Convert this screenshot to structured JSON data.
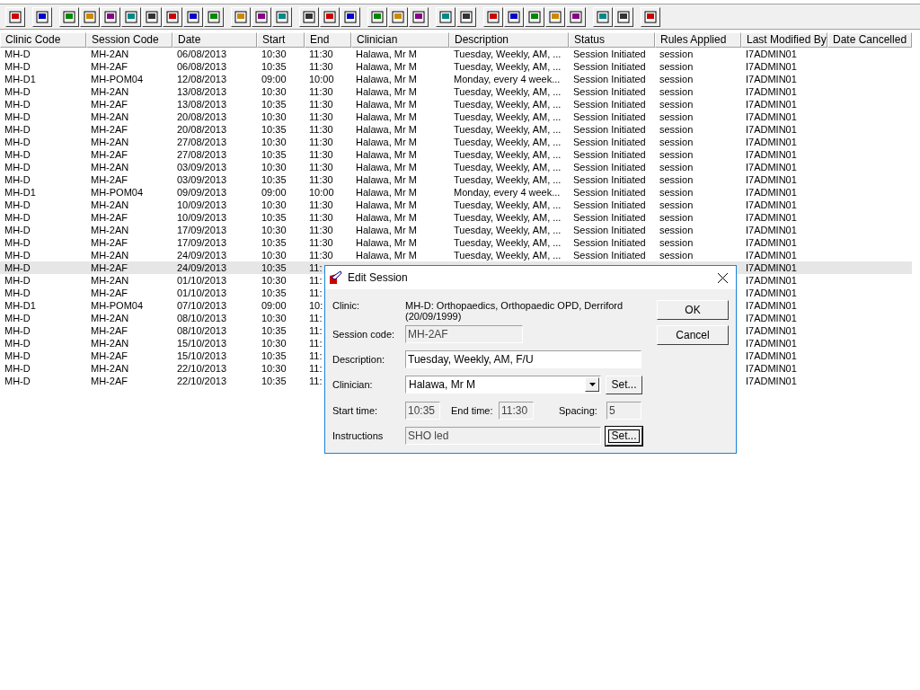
{
  "table": {
    "columns": [
      "Clinic Code",
      "Session Code",
      "Date",
      "Start",
      "End",
      "Clinician",
      "Description",
      "Status",
      "Rules Applied",
      "Last Modified By",
      "Date Cancelled"
    ],
    "rows": [
      {
        "clinic_code": "MH-D",
        "session_code": "MH-2AN",
        "date": "06/08/2013",
        "start": "10:30",
        "end": "11:30",
        "clinician": "Halawa, Mr M",
        "description": "Tuesday, Weekly, AM, ...",
        "status": "Session Initiated",
        "rules_applied": "session",
        "last_modified_by": "I7ADMIN01",
        "selected": false
      },
      {
        "clinic_code": "MH-D",
        "session_code": "MH-2AF",
        "date": "06/08/2013",
        "start": "10:35",
        "end": "11:30",
        "clinician": "Halawa, Mr M",
        "description": "Tuesday, Weekly, AM, ...",
        "status": "Session Initiated",
        "rules_applied": "session",
        "last_modified_by": "I7ADMIN01",
        "selected": false
      },
      {
        "clinic_code": "MH-D1",
        "session_code": "MH-POM04",
        "date": "12/08/2013",
        "start": "09:00",
        "end": "10:00",
        "clinician": "Halawa, Mr M",
        "description": "Monday, every 4 week...",
        "status": "Session Initiated",
        "rules_applied": "session",
        "last_modified_by": "I7ADMIN01",
        "selected": false
      },
      {
        "clinic_code": "MH-D",
        "session_code": "MH-2AN",
        "date": "13/08/2013",
        "start": "10:30",
        "end": "11:30",
        "clinician": "Halawa, Mr M",
        "description": "Tuesday, Weekly, AM, ...",
        "status": "Session Initiated",
        "rules_applied": "session",
        "last_modified_by": "I7ADMIN01",
        "selected": false
      },
      {
        "clinic_code": "MH-D",
        "session_code": "MH-2AF",
        "date": "13/08/2013",
        "start": "10:35",
        "end": "11:30",
        "clinician": "Halawa, Mr M",
        "description": "Tuesday, Weekly, AM, ...",
        "status": "Session Initiated",
        "rules_applied": "session",
        "last_modified_by": "I7ADMIN01",
        "selected": false
      },
      {
        "clinic_code": "MH-D",
        "session_code": "MH-2AN",
        "date": "20/08/2013",
        "start": "10:30",
        "end": "11:30",
        "clinician": "Halawa, Mr M",
        "description": "Tuesday, Weekly, AM, ...",
        "status": "Session Initiated",
        "rules_applied": "session",
        "last_modified_by": "I7ADMIN01",
        "selected": false
      },
      {
        "clinic_code": "MH-D",
        "session_code": "MH-2AF",
        "date": "20/08/2013",
        "start": "10:35",
        "end": "11:30",
        "clinician": "Halawa, Mr M",
        "description": "Tuesday, Weekly, AM, ...",
        "status": "Session Initiated",
        "rules_applied": "session",
        "last_modified_by": "I7ADMIN01",
        "selected": false
      },
      {
        "clinic_code": "MH-D",
        "session_code": "MH-2AN",
        "date": "27/08/2013",
        "start": "10:30",
        "end": "11:30",
        "clinician": "Halawa, Mr M",
        "description": "Tuesday, Weekly, AM, ...",
        "status": "Session Initiated",
        "rules_applied": "session",
        "last_modified_by": "I7ADMIN01",
        "selected": false
      },
      {
        "clinic_code": "MH-D",
        "session_code": "MH-2AF",
        "date": "27/08/2013",
        "start": "10:35",
        "end": "11:30",
        "clinician": "Halawa, Mr M",
        "description": "Tuesday, Weekly, AM, ...",
        "status": "Session Initiated",
        "rules_applied": "session",
        "last_modified_by": "I7ADMIN01",
        "selected": false
      },
      {
        "clinic_code": "MH-D",
        "session_code": "MH-2AN",
        "date": "03/09/2013",
        "start": "10:30",
        "end": "11:30",
        "clinician": "Halawa, Mr M",
        "description": "Tuesday, Weekly, AM, ...",
        "status": "Session Initiated",
        "rules_applied": "session",
        "last_modified_by": "I7ADMIN01",
        "selected": false
      },
      {
        "clinic_code": "MH-D",
        "session_code": "MH-2AF",
        "date": "03/09/2013",
        "start": "10:35",
        "end": "11:30",
        "clinician": "Halawa, Mr M",
        "description": "Tuesday, Weekly, AM, ...",
        "status": "Session Initiated",
        "rules_applied": "session",
        "last_modified_by": "I7ADMIN01",
        "selected": false
      },
      {
        "clinic_code": "MH-D1",
        "session_code": "MH-POM04",
        "date": "09/09/2013",
        "start": "09:00",
        "end": "10:00",
        "clinician": "Halawa, Mr M",
        "description": "Monday, every 4 week...",
        "status": "Session Initiated",
        "rules_applied": "session",
        "last_modified_by": "I7ADMIN01",
        "selected": false
      },
      {
        "clinic_code": "MH-D",
        "session_code": "MH-2AN",
        "date": "10/09/2013",
        "start": "10:30",
        "end": "11:30",
        "clinician": "Halawa, Mr M",
        "description": "Tuesday, Weekly, AM, ...",
        "status": "Session Initiated",
        "rules_applied": "session",
        "last_modified_by": "I7ADMIN01",
        "selected": false
      },
      {
        "clinic_code": "MH-D",
        "session_code": "MH-2AF",
        "date": "10/09/2013",
        "start": "10:35",
        "end": "11:30",
        "clinician": "Halawa, Mr M",
        "description": "Tuesday, Weekly, AM, ...",
        "status": "Session Initiated",
        "rules_applied": "session",
        "last_modified_by": "I7ADMIN01",
        "selected": false
      },
      {
        "clinic_code": "MH-D",
        "session_code": "MH-2AN",
        "date": "17/09/2013",
        "start": "10:30",
        "end": "11:30",
        "clinician": "Halawa, Mr M",
        "description": "Tuesday, Weekly, AM, ...",
        "status": "Session Initiated",
        "rules_applied": "session",
        "last_modified_by": "I7ADMIN01",
        "selected": false
      },
      {
        "clinic_code": "MH-D",
        "session_code": "MH-2AF",
        "date": "17/09/2013",
        "start": "10:35",
        "end": "11:30",
        "clinician": "Halawa, Mr M",
        "description": "Tuesday, Weekly, AM, ...",
        "status": "Session Initiated",
        "rules_applied": "session",
        "last_modified_by": "I7ADMIN01",
        "selected": false
      },
      {
        "clinic_code": "MH-D",
        "session_code": "MH-2AN",
        "date": "24/09/2013",
        "start": "10:30",
        "end": "11:30",
        "clinician": "Halawa, Mr M",
        "description": "Tuesday, Weekly, AM, ...",
        "status": "Session Initiated",
        "rules_applied": "session",
        "last_modified_by": "I7ADMIN01",
        "selected": false
      },
      {
        "clinic_code": "MH-D",
        "session_code": "MH-2AF",
        "date": "24/09/2013",
        "start": "10:35",
        "end": "11:",
        "last_modified_by": "I7ADMIN01",
        "selected": true
      },
      {
        "clinic_code": "MH-D",
        "session_code": "MH-2AN",
        "date": "01/10/2013",
        "start": "10:30",
        "end": "11:",
        "last_modified_by": "I7ADMIN01",
        "selected": false
      },
      {
        "clinic_code": "MH-D",
        "session_code": "MH-2AF",
        "date": "01/10/2013",
        "start": "10:35",
        "end": "11:",
        "last_modified_by": "I7ADMIN01",
        "selected": false
      },
      {
        "clinic_code": "MH-D1",
        "session_code": "MH-POM04",
        "date": "07/10/2013",
        "start": "09:00",
        "end": "10:",
        "last_modified_by": "I7ADMIN01",
        "selected": false
      },
      {
        "clinic_code": "MH-D",
        "session_code": "MH-2AN",
        "date": "08/10/2013",
        "start": "10:30",
        "end": "11:",
        "last_modified_by": "I7ADMIN01",
        "selected": false
      },
      {
        "clinic_code": "MH-D",
        "session_code": "MH-2AF",
        "date": "08/10/2013",
        "start": "10:35",
        "end": "11:",
        "last_modified_by": "I7ADMIN01",
        "selected": false
      },
      {
        "clinic_code": "MH-D",
        "session_code": "MH-2AN",
        "date": "15/10/2013",
        "start": "10:30",
        "end": "11:",
        "last_modified_by": "I7ADMIN01",
        "selected": false
      },
      {
        "clinic_code": "MH-D",
        "session_code": "MH-2AF",
        "date": "15/10/2013",
        "start": "10:35",
        "end": "11:",
        "last_modified_by": "I7ADMIN01",
        "selected": false
      },
      {
        "clinic_code": "MH-D",
        "session_code": "MH-2AN",
        "date": "22/10/2013",
        "start": "10:30",
        "end": "11:",
        "last_modified_by": "I7ADMIN01",
        "selected": false
      },
      {
        "clinic_code": "MH-D",
        "session_code": "MH-2AF",
        "date": "22/10/2013",
        "start": "10:35",
        "end": "11:",
        "last_modified_by": "I7ADMIN01",
        "selected": false
      }
    ]
  },
  "dialog": {
    "title": "Edit Session",
    "clinic": {
      "label": "Clinic:",
      "value": "MH-D: Orthopaedics, Orthopaedic OPD, Derriford (20/09/1999)"
    },
    "session_code": {
      "label": "Session code:",
      "value": "MH-2AF",
      "disabled": true
    },
    "description": {
      "label": "Description:",
      "value": "Tuesday, Weekly, AM, F/U",
      "disabled": false
    },
    "clinician": {
      "label": "Clinician:",
      "value": "Halawa, Mr M",
      "disabled": false,
      "button": {
        "label": "Set...",
        "focused": false
      }
    },
    "start_time": {
      "label": "Start time:",
      "value": "10:35",
      "disabled": true
    },
    "end_time": {
      "label": "End time:",
      "value": "11:30",
      "disabled": true
    },
    "spacing": {
      "label": "Spacing:",
      "value": "5",
      "disabled": true
    },
    "instructions": {
      "label": "Instructions",
      "value": "SHO led",
      "disabled": true,
      "button": {
        "label": "Set...",
        "focused": true
      }
    },
    "buttons": [
      {
        "label": "OK"
      },
      {
        "label": "Cancel"
      }
    ]
  }
}
